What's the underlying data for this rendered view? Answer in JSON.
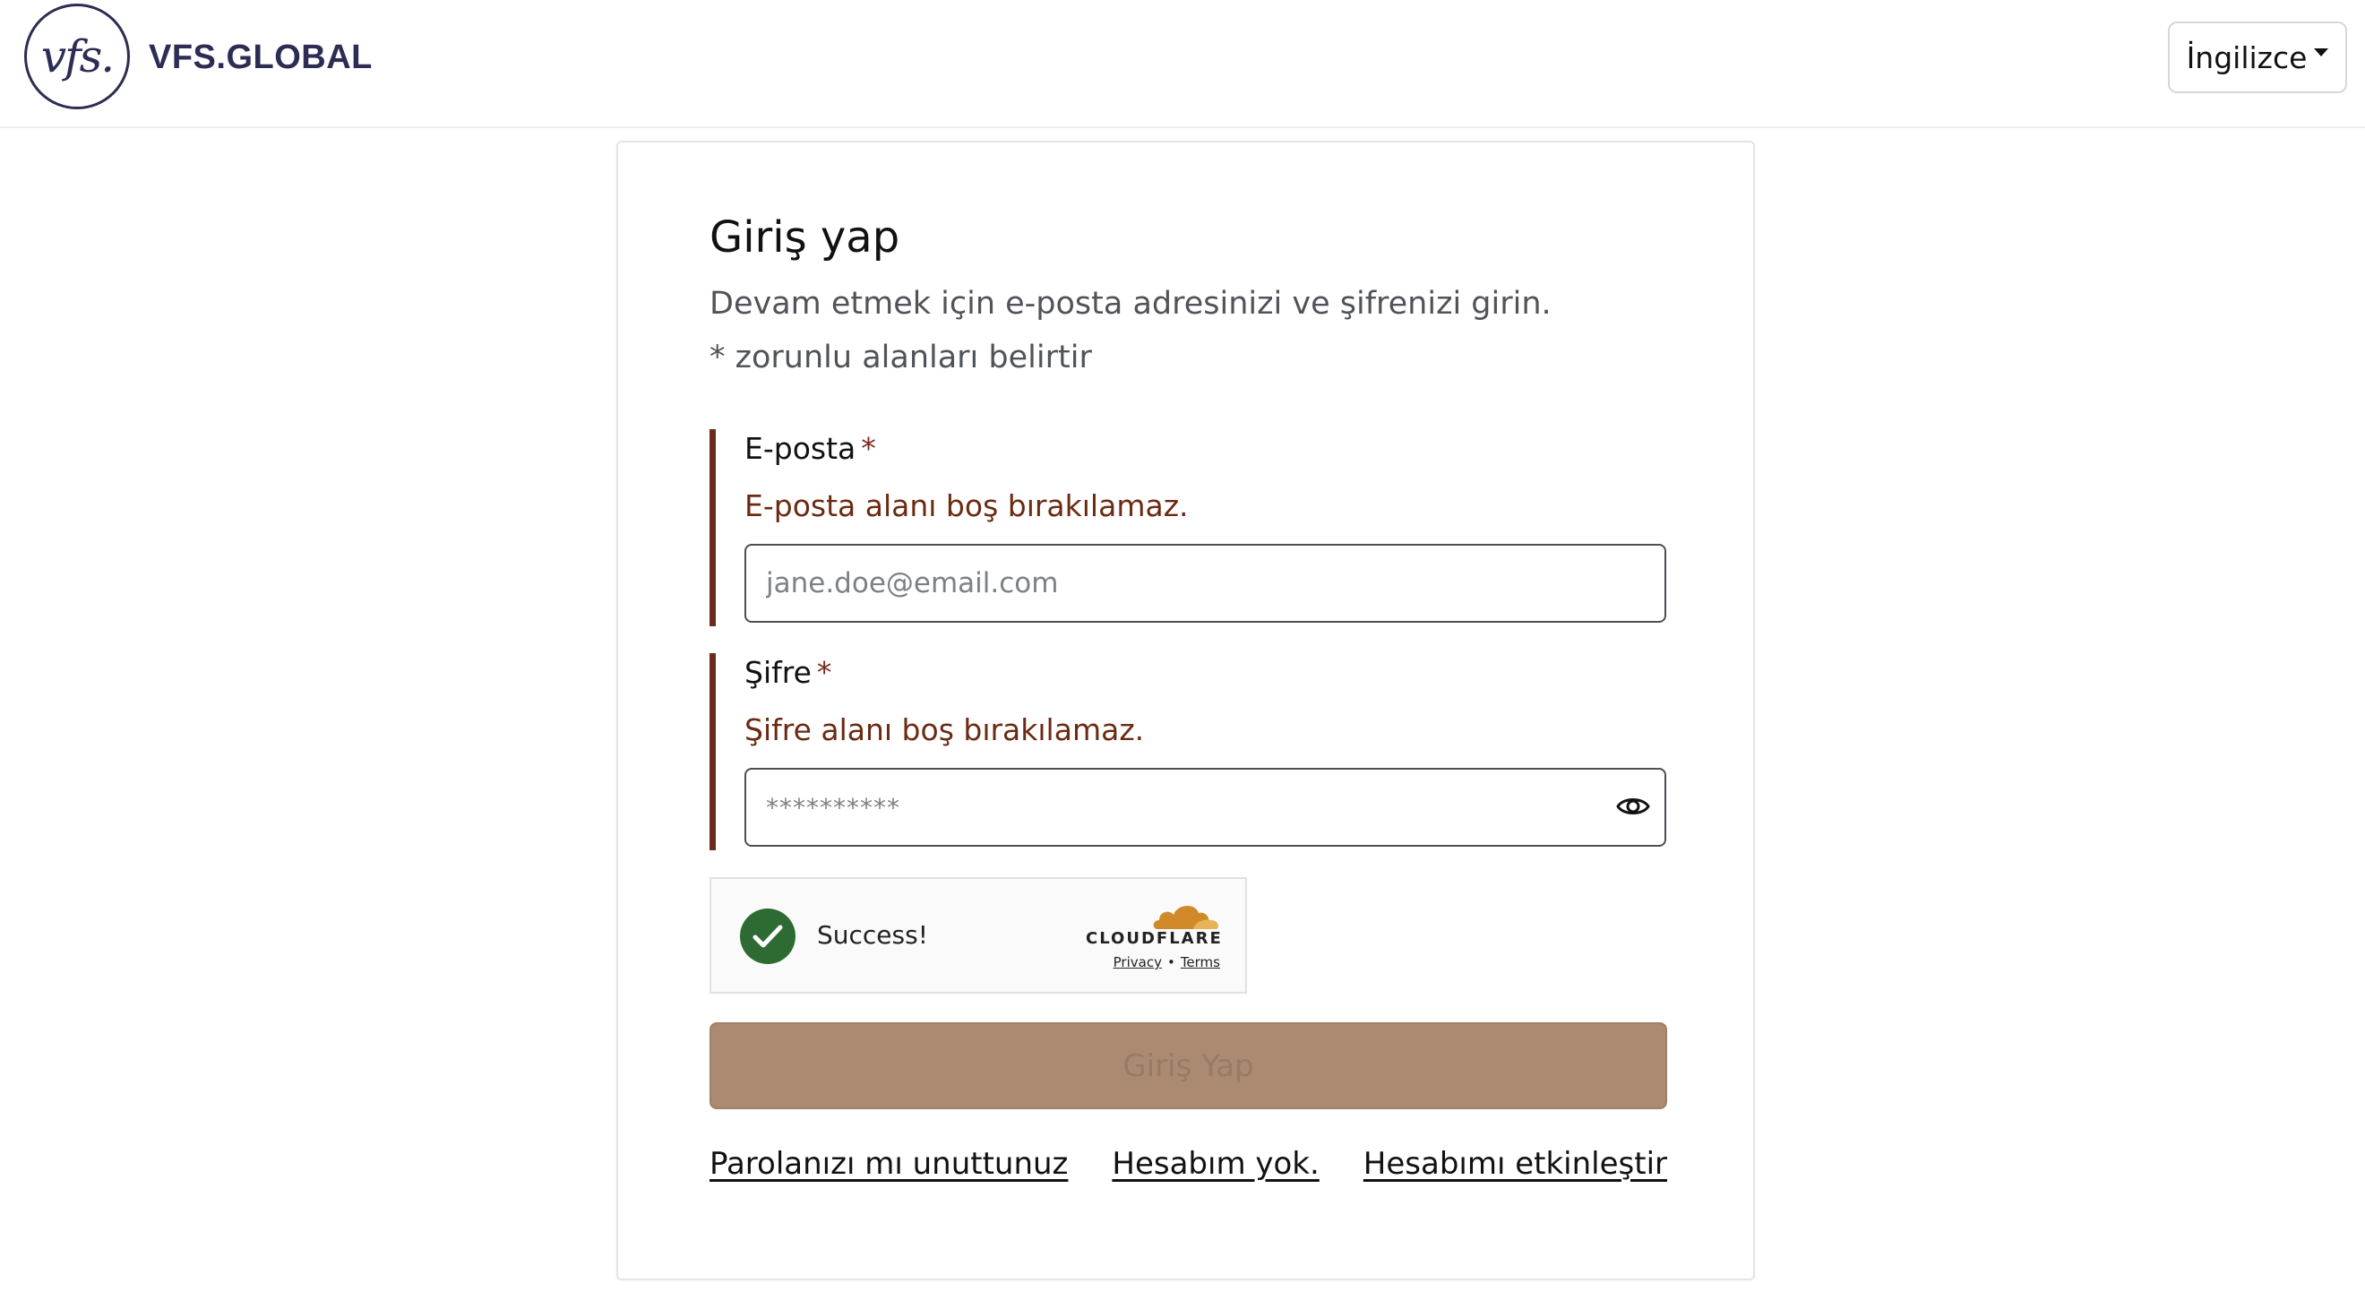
{
  "header": {
    "logo_mark": "vfs.",
    "logo_text": "VFS.GLOBAL",
    "language_label": "İngilizce"
  },
  "login": {
    "title": "Giriş yap",
    "subtitle": "Devam etmek için e-posta adresinizi ve şifrenizi girin.",
    "required_note": "* zorunlu alanları belirtir",
    "email": {
      "label": "E-posta",
      "required_mark": "*",
      "error": "E-posta alanı boş bırakılamaz.",
      "value": "",
      "placeholder": "jane.doe@email.com"
    },
    "password": {
      "label": "Şifre",
      "required_mark": "*",
      "error": "Şifre alanı boş bırakılamaz.",
      "value": "",
      "placeholder": "**********"
    },
    "captcha": {
      "status": "Success!",
      "brand": "CLOUDFLARE",
      "privacy": "Privacy",
      "separator": "•",
      "terms": "Terms"
    },
    "submit_label": "Giriş Yap",
    "links": {
      "forgot": "Parolanızı mı unuttunuz",
      "no_account": "Hesabım yok.",
      "activate": "Hesabımı etkinleştir"
    }
  },
  "colors": {
    "accent": "#6d2b1e",
    "error_text": "#6b2a12",
    "button_disabled": "#ab8a71",
    "success_green": "#2e6b33",
    "brand_navy": "#2c2c54"
  }
}
